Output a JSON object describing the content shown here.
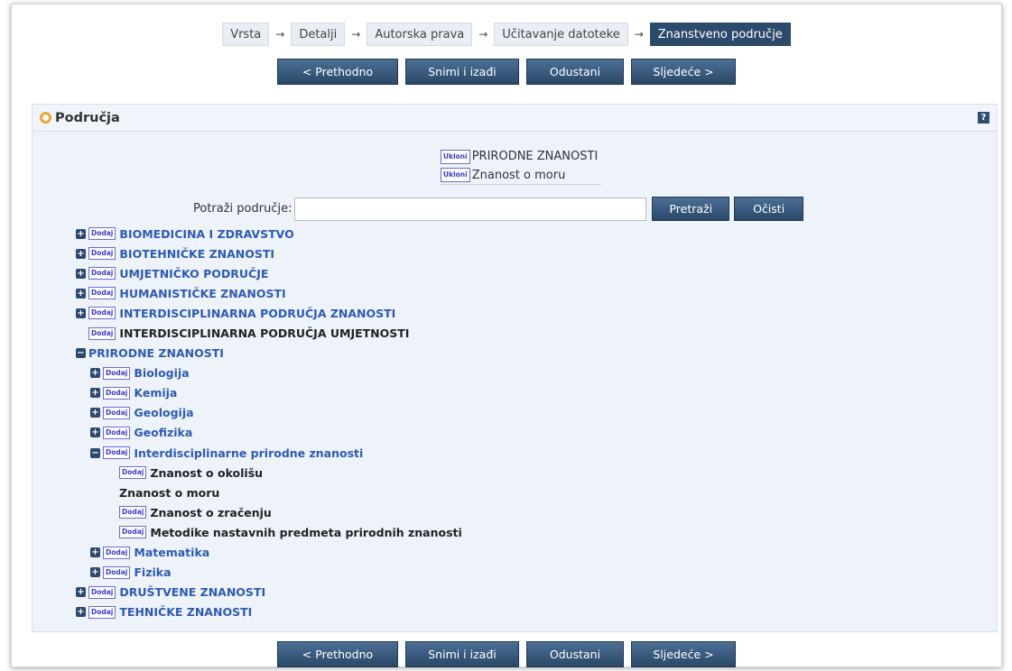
{
  "wizard": {
    "steps": [
      {
        "label": "Vrsta",
        "active": false
      },
      {
        "label": "Detalji",
        "active": false
      },
      {
        "label": "Autorska prava",
        "active": false
      },
      {
        "label": "Učitavanje datoteke",
        "active": false
      },
      {
        "label": "Znanstveno područje",
        "active": true
      }
    ],
    "arrow": "→"
  },
  "nav_buttons": {
    "prev": "< Prethodno",
    "save_exit": "Snimi i izađi",
    "cancel": "Odustani",
    "next": "Sljedeće >"
  },
  "panel": {
    "title": "Područja",
    "help_icon": "?"
  },
  "selected": {
    "remove_label": "Ukloni",
    "items": [
      "PRIRODNE ZNANOSTI",
      "Znanost o moru"
    ]
  },
  "search": {
    "label": "Potraži područje:",
    "value": "",
    "placeholder": "",
    "search_button": "Pretraži",
    "clear_button": "Očisti"
  },
  "tree": {
    "add_label": "Dodaj",
    "expand_icon": "+",
    "collapse_icon": "−",
    "nodes": [
      {
        "label": "BIOMEDICINA I ZDRAVSTVO"
      },
      {
        "label": "BIOTEHNIČKE ZNANOSTI"
      },
      {
        "label": "UMJETNIČKO PODRUČJE"
      },
      {
        "label": "HUMANISTIČKE ZNANOSTI"
      },
      {
        "label": "INTERDISCIPLINARNA PODRUČJA ZNANOSTI"
      },
      {
        "label": "INTERDISCIPLINARNA PODRUČJA UMJETNOSTI"
      },
      {
        "label": "PRIRODNE ZNANOSTI"
      },
      {
        "label": "Biologija"
      },
      {
        "label": "Kemija"
      },
      {
        "label": "Geologija"
      },
      {
        "label": "Geofizika"
      },
      {
        "label": "Interdisciplinarne prirodne znanosti"
      },
      {
        "label": "Znanost o okolišu"
      },
      {
        "label": "Znanost o moru"
      },
      {
        "label": "Znanost o zračenju"
      },
      {
        "label": "Metodike nastavnih predmeta prirodnih znanosti"
      },
      {
        "label": "Matematika"
      },
      {
        "label": "Fizika"
      },
      {
        "label": "DRUŠTVENE ZNANOSTI"
      },
      {
        "label": "TEHNIČKE ZNANOSTI"
      }
    ]
  }
}
